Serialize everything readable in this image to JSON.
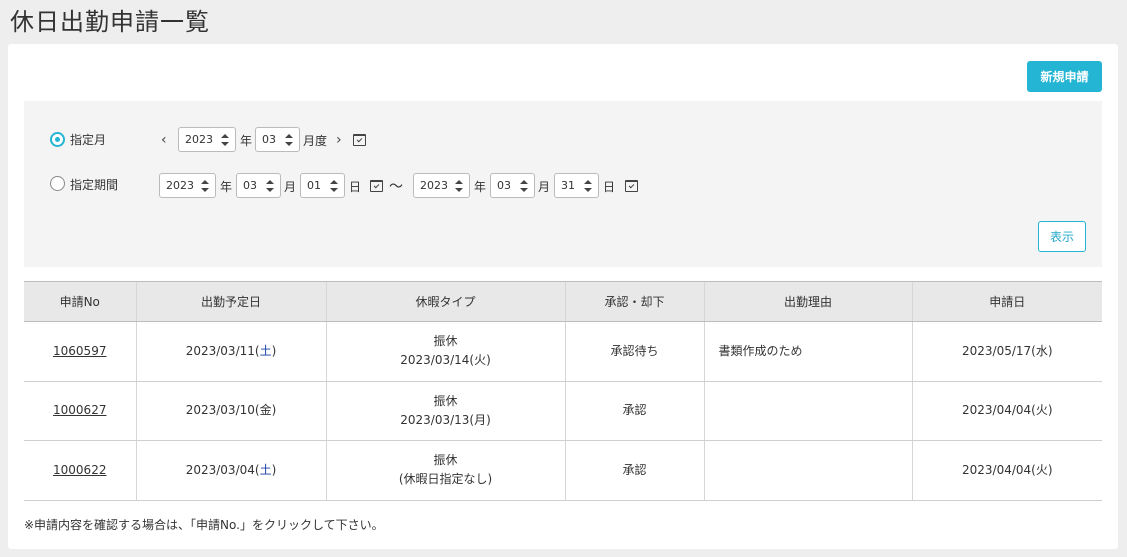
{
  "page": {
    "title": "休日出勤申請一覧"
  },
  "actions": {
    "new_label": "新規申請",
    "show_label": "表示"
  },
  "filter": {
    "month_mode_label": "指定月",
    "period_mode_label": "指定期間",
    "selected_mode": "month",
    "month": {
      "year": "2023",
      "month": "03",
      "year_unit": "年",
      "month_unit": "月度"
    },
    "period": {
      "from_year": "2023",
      "from_month": "03",
      "from_day": "01",
      "to_year": "2023",
      "to_month": "03",
      "to_day": "31",
      "year_unit": "年",
      "month_unit": "月",
      "day_unit": "日",
      "separator": "〜"
    }
  },
  "table": {
    "headers": [
      "申請No",
      "出勤予定日",
      "休暇タイプ",
      "承認・却下",
      "出勤理由",
      "申請日"
    ],
    "rows": [
      {
        "no": "1060597",
        "date": "2023/03/11(",
        "dow": "土",
        "date_end": ")",
        "type": "振休",
        "type_date": "2023/03/14(火)",
        "status": "承認待ち",
        "reason": "書類作成のため",
        "applied": "2023/05/17(水)"
      },
      {
        "no": "1000627",
        "date": "2023/03/10(",
        "dow": "金",
        "date_end": ")",
        "type": "振休",
        "type_date": "2023/03/13(月)",
        "status": "承認",
        "reason": "",
        "applied": "2023/04/04(火)"
      },
      {
        "no": "1000622",
        "date": "2023/03/04(",
        "dow": "土",
        "date_end": ")",
        "type": "振休",
        "type_date": "(休暇日指定なし)",
        "status": "承認",
        "reason": "",
        "applied": "2023/04/04(火)"
      }
    ]
  },
  "note": "※申請内容を確認する場合は、「申請No.」をクリックして下さい。",
  "colors": {
    "accent": "#23b5d3",
    "saturday": "#1a3fa8"
  }
}
